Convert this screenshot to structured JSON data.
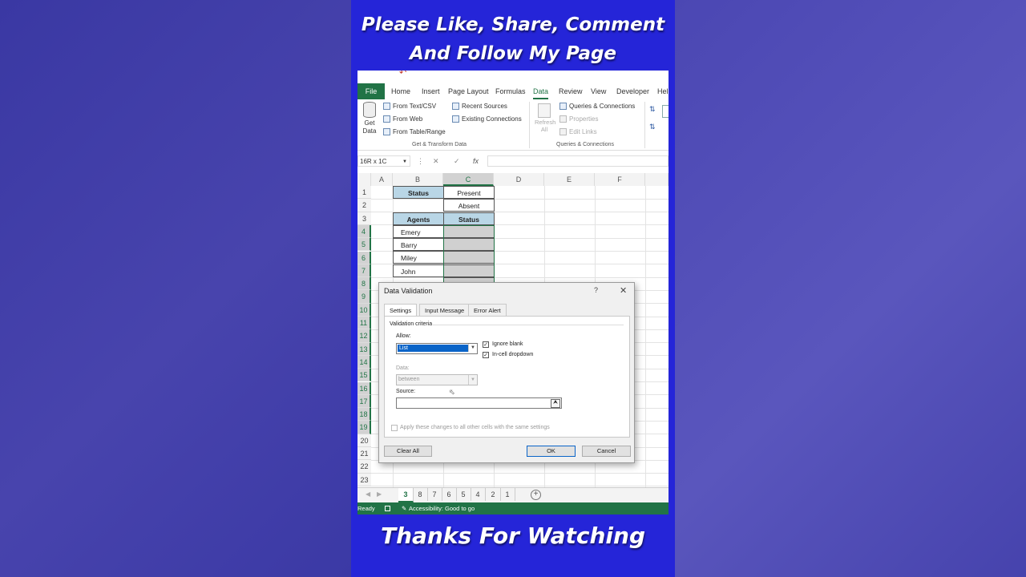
{
  "overlay": {
    "caption_top_line1": "Please Like, Share, Comment",
    "caption_top_line2": "And Follow My Page",
    "caption_bottom": "Thanks For Watching"
  },
  "ribbon": {
    "tabs": [
      "File",
      "Home",
      "Insert",
      "Page Layout",
      "Formulas",
      "Data",
      "Review",
      "View",
      "Developer",
      "Hel"
    ],
    "active_tab": "Data",
    "get_data": "Get Data",
    "from_text_csv": "From Text/CSV",
    "from_web": "From Web",
    "from_table_range": "From Table/Range",
    "recent_sources": "Recent Sources",
    "existing_connections": "Existing Connections",
    "group_get_transform": "Get & Transform Data",
    "refresh_all": "Refresh All",
    "queries_connections": "Queries & Connections",
    "properties": "Properties",
    "edit_links": "Edit Links",
    "group_queries": "Queries & Connections"
  },
  "formula_bar": {
    "name_box": "16R x 1C",
    "value": ""
  },
  "sheet": {
    "columns": [
      "A",
      "B",
      "C",
      "D",
      "E",
      "F"
    ],
    "rows": [
      "1",
      "2",
      "3",
      "4",
      "5",
      "6",
      "7",
      "8",
      "9",
      "10",
      "11",
      "12",
      "13",
      "14",
      "15",
      "16",
      "17",
      "18",
      "19",
      "20",
      "21",
      "22",
      "23"
    ],
    "b1": "Status",
    "c1": "Present",
    "c2": "Absent",
    "b3": "Agents",
    "c3": "Status",
    "agents": [
      "Emery",
      "Barry",
      "Miley",
      "John"
    ]
  },
  "sheet_tabs": [
    "3",
    "8",
    "7",
    "6",
    "5",
    "4",
    "2",
    "1"
  ],
  "status_bar": {
    "ready": "Ready",
    "accessibility": "Accessibility: Good to go"
  },
  "dialog": {
    "title": "Data Validation",
    "help": "?",
    "tabs": [
      "Settings",
      "Input Message",
      "Error Alert"
    ],
    "section": "Validation criteria",
    "allow_label": "Allow:",
    "allow_value": "List",
    "data_label": "Data:",
    "data_value": "between",
    "ignore_blank": "Ignore blank",
    "in_cell_dropdown": "In-cell dropdown",
    "source_label": "Source:",
    "source_value": "",
    "apply_all": "Apply these changes to all other cells with the same settings",
    "clear_all": "Clear All",
    "ok": "OK",
    "cancel": "Cancel"
  },
  "colors": {
    "excel_green": "#217346",
    "panel_blue": "#2525d8",
    "header_cell": "#b9d6e6"
  }
}
